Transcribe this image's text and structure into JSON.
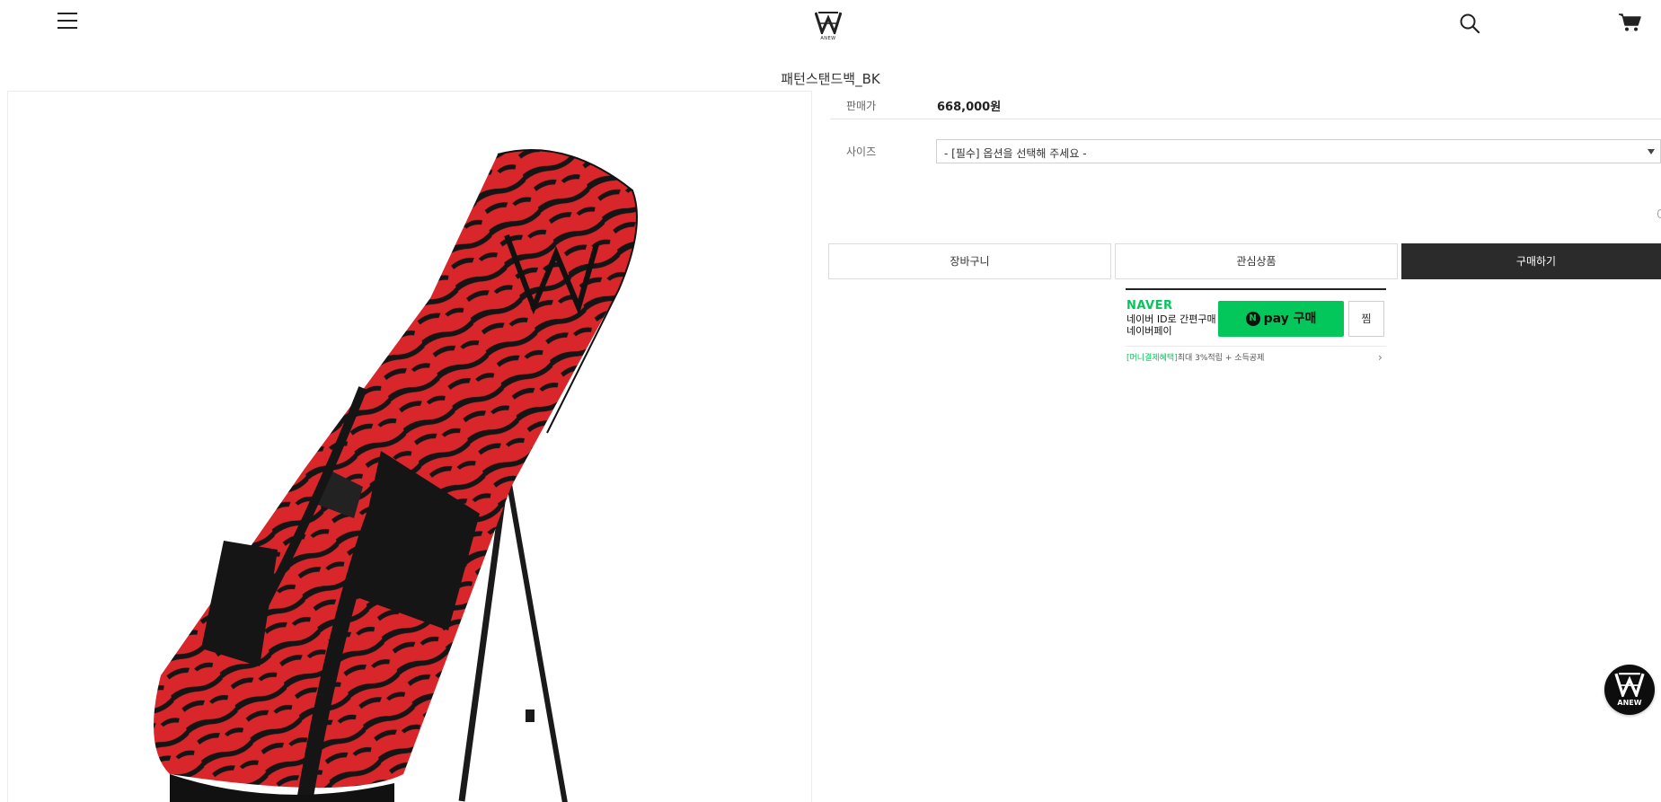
{
  "header": {
    "logo_text": "ANEW",
    "menu_icon": "hamburger-menu-icon",
    "search_icon": "search-icon",
    "cart_icon": "cart-icon"
  },
  "product": {
    "title": "패턴스탠드백_BK",
    "price_label": "판매가",
    "price_value": "668,000원",
    "size_label": "사이즈",
    "size_select_value": "- [필수] 옵션을 선택해 주세요 -"
  },
  "actions": {
    "cart_label": "장바구니",
    "wishlist_label": "관심상품",
    "buy_label": "구매하기"
  },
  "naverpay": {
    "brand": "NAVER",
    "desc_line1": "네이버 ID로 간편구매",
    "desc_line2": "네이버페이",
    "button_n": "N",
    "button_label": "pay 구매",
    "zzim_label": "찜",
    "benefit_highlight": "[머니결제혜택]",
    "benefit_text": "최대 3%적립 + 소득공제",
    "arrow": "›"
  },
  "floating": {
    "logo_text": "ANEW"
  },
  "colors": {
    "naver_green": "#03c75a",
    "buy_button": "#2b2b2b",
    "bag_red": "#d8262b",
    "bag_black": "#151515"
  }
}
